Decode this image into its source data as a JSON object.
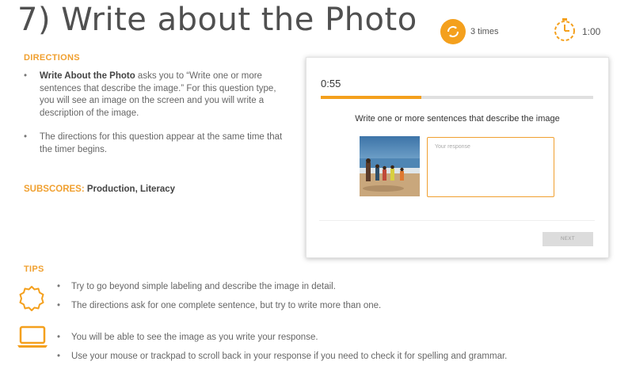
{
  "header": {
    "title": "7) Write about the Photo",
    "repeat_label": "3 times",
    "timer_label": "1:00"
  },
  "directions": {
    "heading": "DIRECTIONS",
    "items": [
      {
        "bold": "Write About the Photo",
        "text": " asks you to “Write one or more sentences that describe the image.” For this question type, you will see an image on the screen and you will write a description of the image."
      },
      {
        "bold": "",
        "text": "The directions for this question appear at the same time that the timer begins."
      }
    ],
    "subscores_label": "SUBSCORES:",
    "subscores_value": "Production, Literacy"
  },
  "mock_question": {
    "timer": "0:55",
    "progress_fraction": 0.37,
    "prompt": "Write one or more sentences that describe the image",
    "response_placeholder": "Your response",
    "next_label": "NEXT"
  },
  "tips": {
    "heading": "TIPS",
    "group1": [
      "Try to go beyond simple labeling and describe the image in detail.",
      "The directions ask for one complete sentence, but try to write more than one."
    ],
    "group2": [
      "You will be able to see the image as you write your response.",
      "Use your mouse or trackpad to scroll back in your response if you need to check it for spelling and grammar."
    ]
  },
  "colors": {
    "accent": "#f4a01d",
    "heading": "#f0a030",
    "text": "#666666"
  },
  "icons": [
    "repeat-icon",
    "stopwatch-icon",
    "badge-icon",
    "laptop-icon"
  ]
}
